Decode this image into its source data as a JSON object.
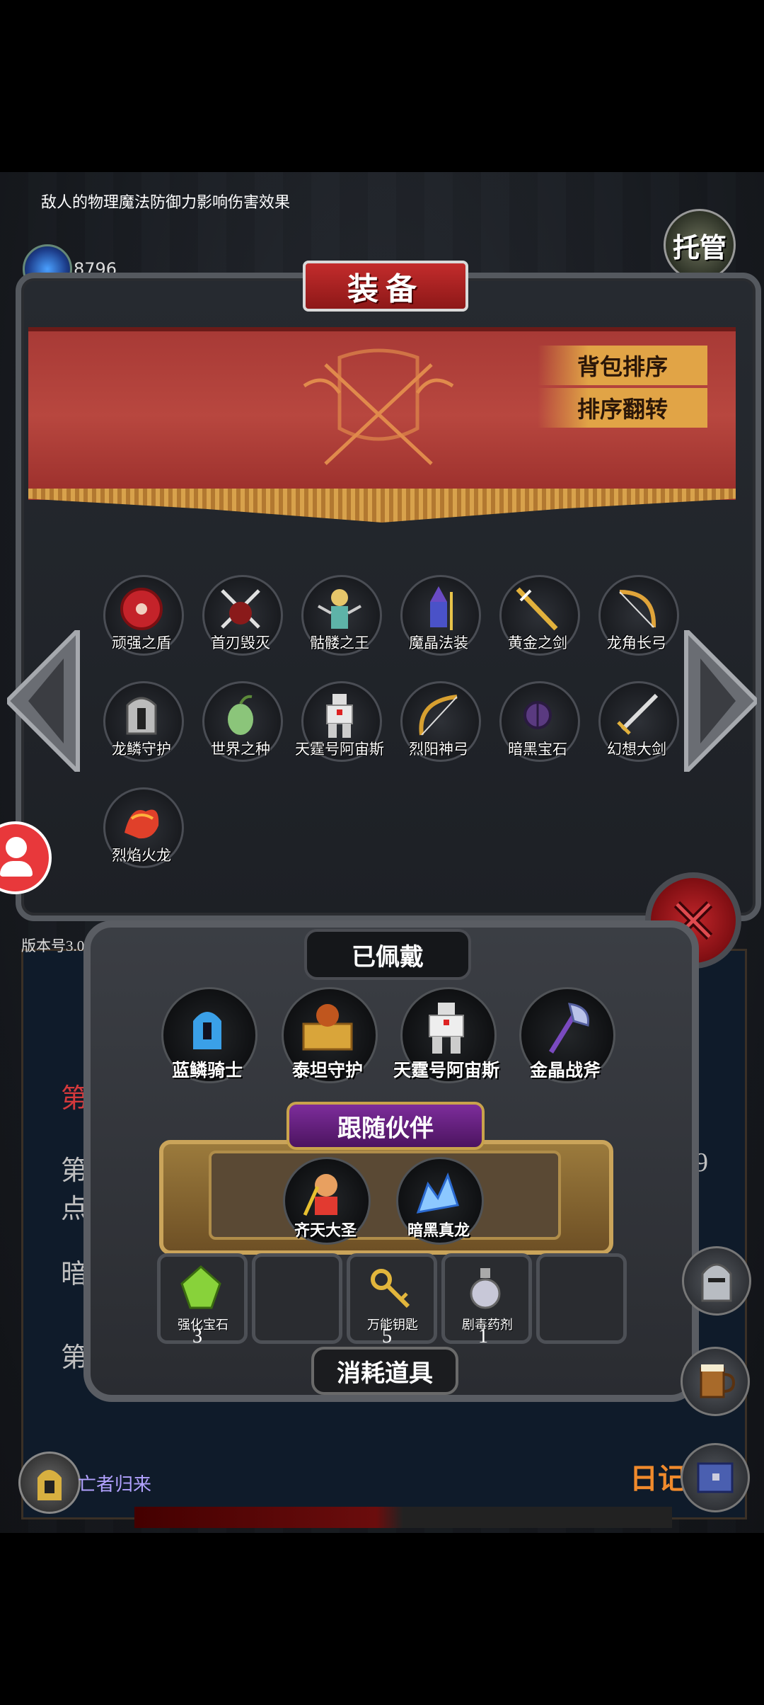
{
  "hint_text": "敌人的物理魔法防御力影响伤害效果",
  "gem": {
    "label": "宝石",
    "count": "8796"
  },
  "auto_button": "托管",
  "equipment_panel": {
    "title": "装备",
    "sort_bag": "背包排序",
    "sort_reverse": "排序翻转",
    "items": [
      {
        "label": "顽强之盾",
        "icon": "shield-icon"
      },
      {
        "label": "首刃毁灭",
        "icon": "blade-icon"
      },
      {
        "label": "骷髅之王",
        "icon": "skeleton-icon"
      },
      {
        "label": "魔晶法装",
        "icon": "wizard-icon"
      },
      {
        "label": "黄金之剑",
        "icon": "golden-sword-icon"
      },
      {
        "label": "龙角长弓",
        "icon": "bow-icon"
      },
      {
        "label": "龙鳞守护",
        "icon": "helmet-icon"
      },
      {
        "label": "世界之种",
        "icon": "seed-icon"
      },
      {
        "label": "天霆号阿宙斯",
        "icon": "robot-icon"
      },
      {
        "label": "烈阳神弓",
        "icon": "sun-bow-icon"
      },
      {
        "label": "暗黑宝石",
        "icon": "dark-gem-icon"
      },
      {
        "label": "幻想大剑",
        "icon": "great-sword-icon"
      },
      {
        "label": "烈焰火龙",
        "icon": "fire-dragon-icon"
      }
    ]
  },
  "version": "版本号3.08",
  "worn_panel": {
    "title": "已佩戴",
    "items": [
      {
        "label": "蓝鳞骑士",
        "icon": "knight-icon"
      },
      {
        "label": "泰坦守护",
        "icon": "titan-icon"
      },
      {
        "label": "天霆号阿宙斯",
        "icon": "robot-icon"
      },
      {
        "label": "金晶战斧",
        "icon": "axe-icon"
      }
    ],
    "partner_title": "跟随伙伴",
    "partners": [
      {
        "label": "齐天大圣",
        "icon": "monkey-king-icon"
      },
      {
        "label": "暗黑真龙",
        "icon": "ice-dragon-icon"
      }
    ],
    "consumables_title": "消耗道具",
    "consumables": [
      {
        "label": "强化宝石",
        "count": "3",
        "icon": "green-gem-icon"
      },
      {
        "label": "",
        "count": "",
        "icon": ""
      },
      {
        "label": "万能钥匙",
        "count": "5",
        "icon": "key-icon"
      },
      {
        "label": "剧毒药剂",
        "count": "1",
        "icon": "potion-icon"
      },
      {
        "label": "",
        "count": "",
        "icon": ""
      }
    ]
  },
  "background_texts": {
    "left_1": "第",
    "left_2": "第",
    "left_3": "点",
    "left_4": "暗",
    "left_5": "第",
    "right_number": "459"
  },
  "diary_label": "日记",
  "return_text": "亡者归来"
}
